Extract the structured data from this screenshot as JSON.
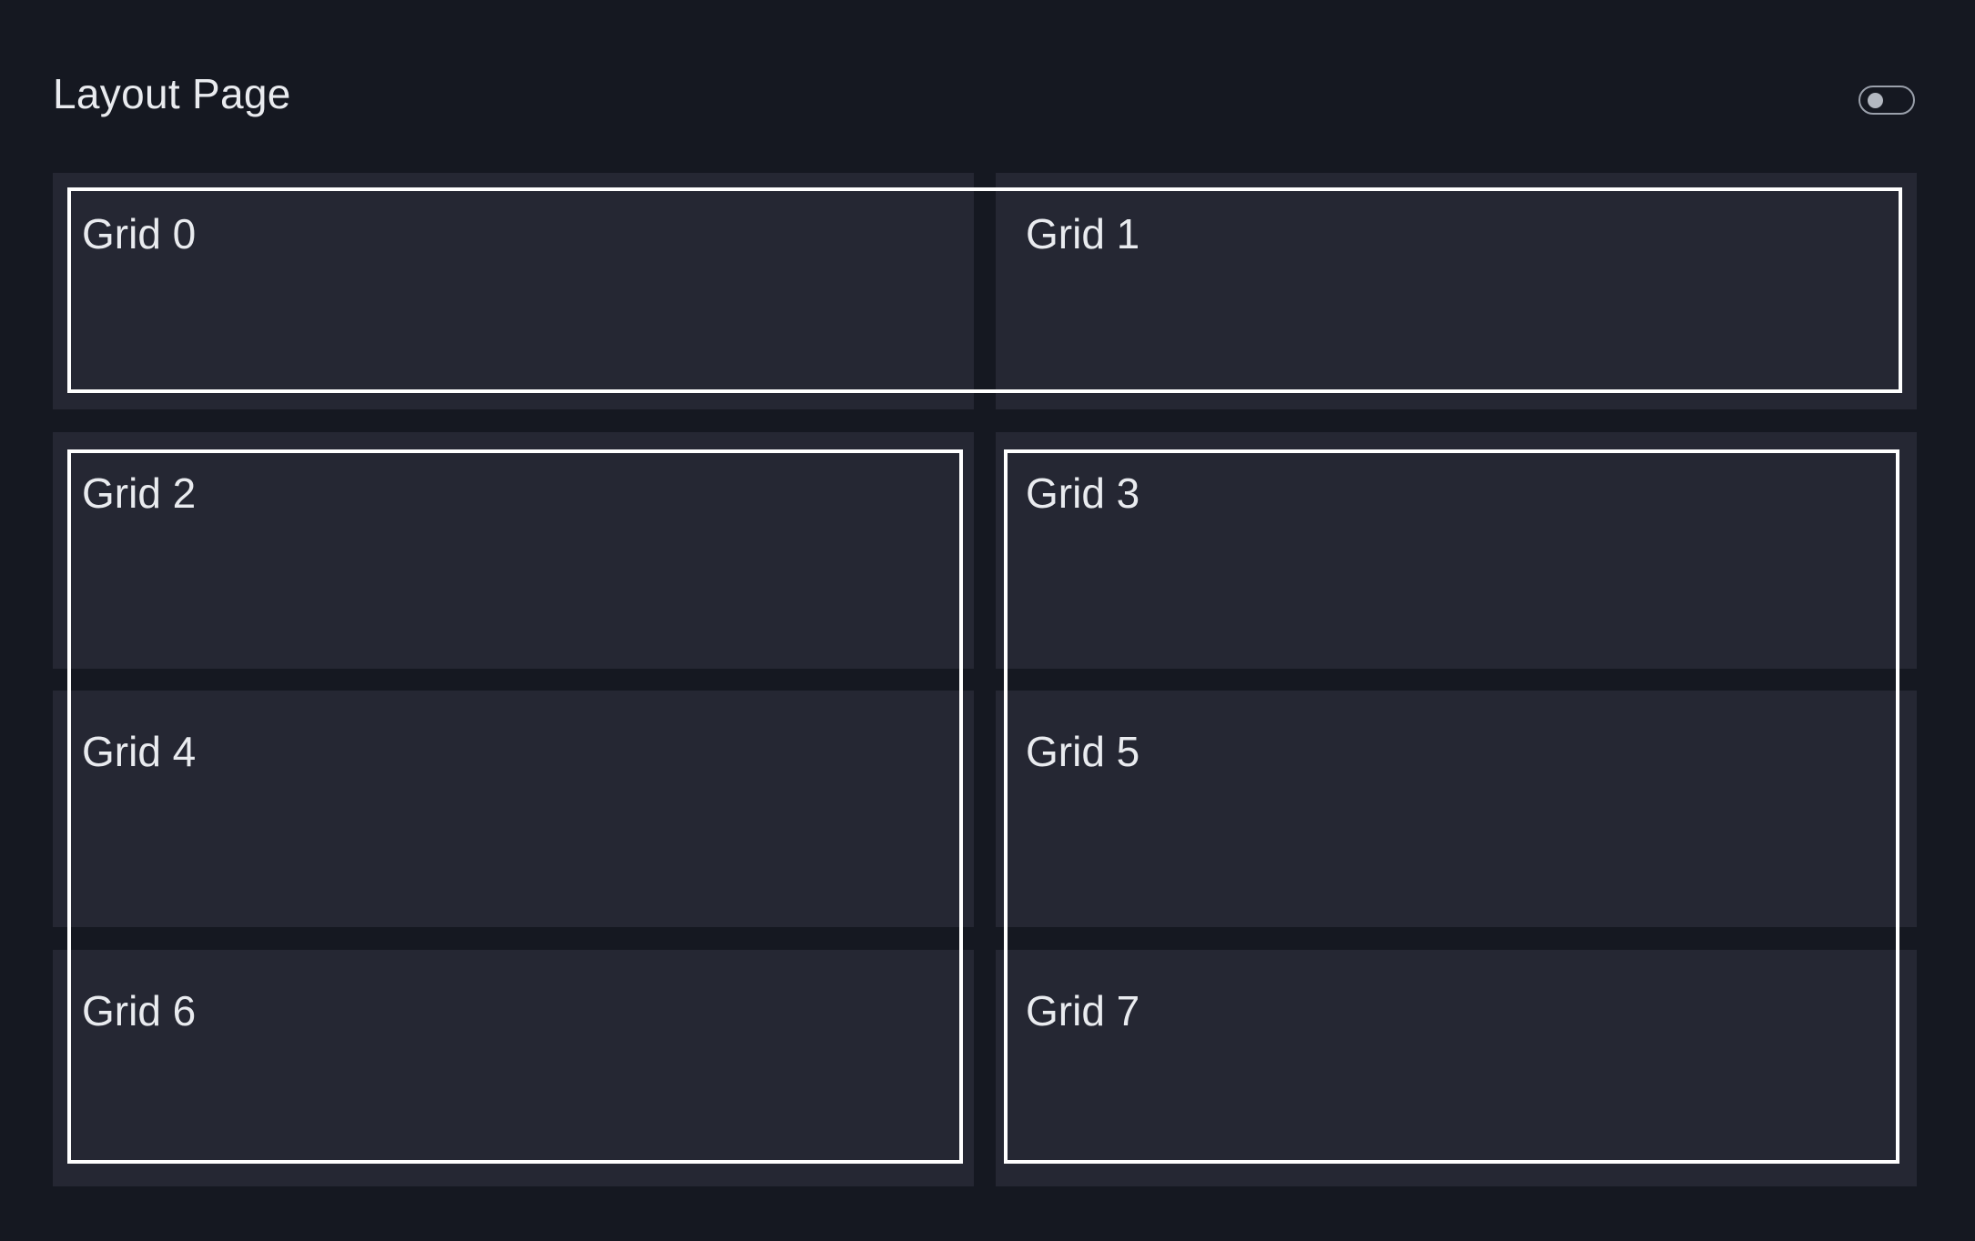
{
  "header": {
    "title": "Layout Page",
    "toggle_icon": "toggle-switch-icon"
  },
  "grids": [
    {
      "label": "Grid 0"
    },
    {
      "label": "Grid 1"
    },
    {
      "label": "Grid 2"
    },
    {
      "label": "Grid 3"
    },
    {
      "label": "Grid 4"
    },
    {
      "label": "Grid 5"
    },
    {
      "label": "Grid 6"
    },
    {
      "label": "Grid 7"
    }
  ],
  "colors": {
    "background": "#151821",
    "cell": "#252733",
    "outline": "#ffffff",
    "text": "#e9ebef"
  }
}
